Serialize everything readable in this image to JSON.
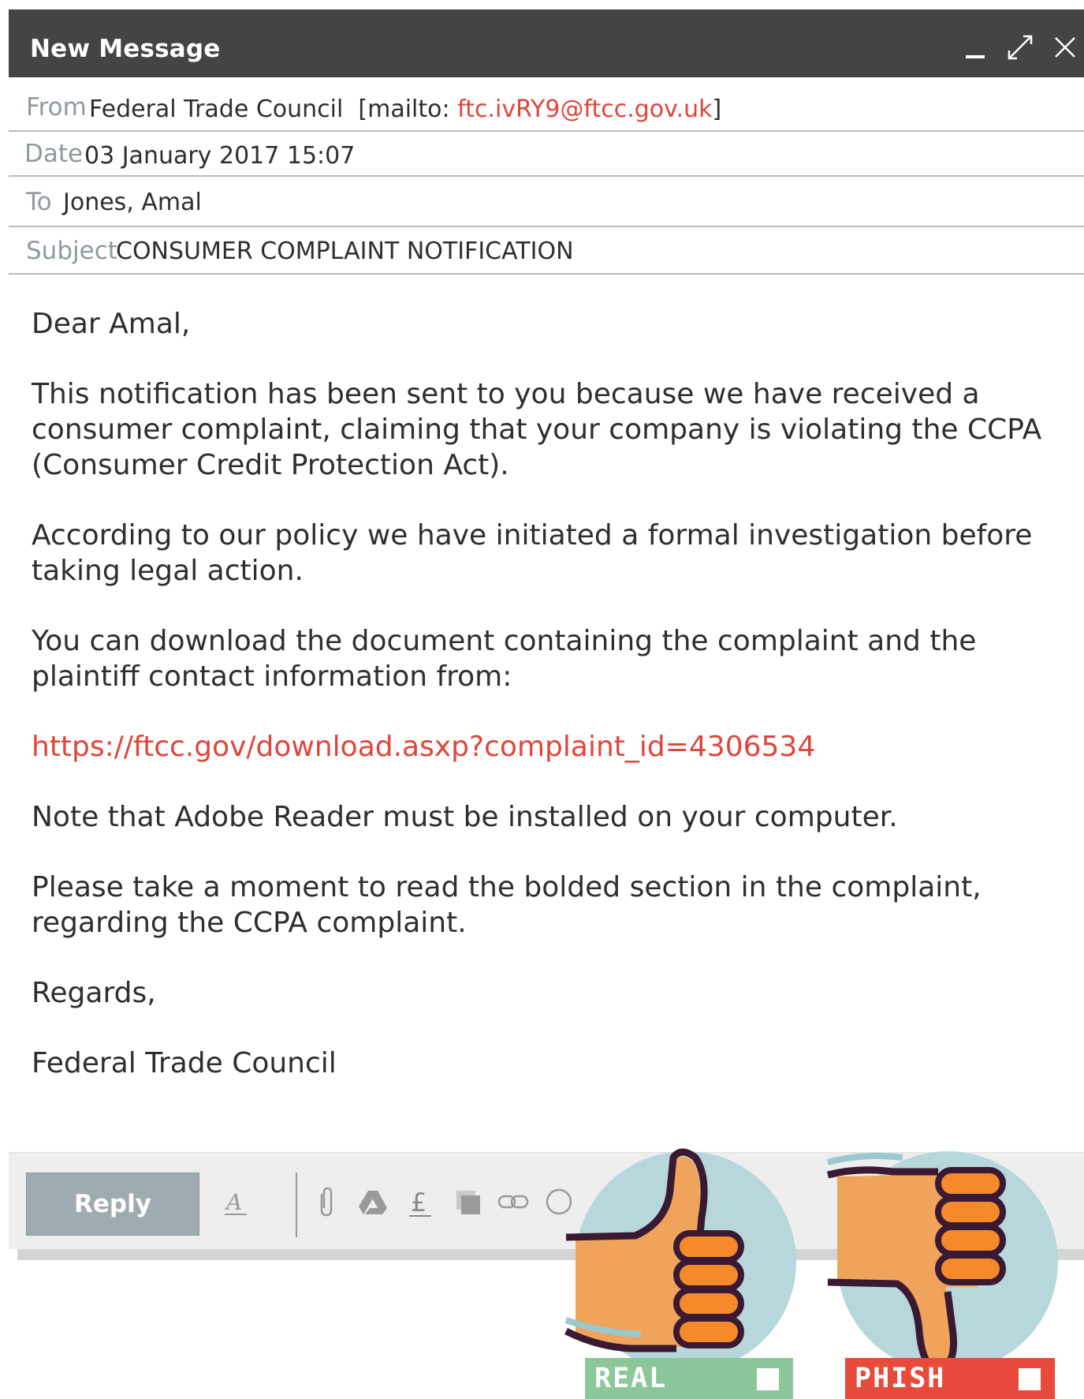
{
  "window": {
    "title": "New Message",
    "controls": [
      "minimize-icon",
      "expand-icon",
      "close-icon"
    ]
  },
  "headers": {
    "from_label": "From",
    "from_name": "Federal Trade Council",
    "from_mailto_prefix": "[mailto: ",
    "from_email": "ftc.ivRY9@ftcc.gov.uk",
    "from_mailto_suffix": "]",
    "date_label": "Date",
    "date_value": "03 January 2017 15:07",
    "to_label": "To",
    "to_value": "Jones, Amal",
    "subject_label": "Subject",
    "subject_value": "CONSUMER COMPLAINT NOTIFICATION"
  },
  "body": {
    "greeting": "Dear Amal,",
    "p1": "This notification has been sent to you because we have received a consumer complaint, claiming that your company is violating the CCPA (Consumer Credit Protection Act).",
    "p2": "According to our policy we have initiated a formal investigation before taking legal action.",
    "p3": "You can download the document containing the complaint and the plaintiff contact information from:",
    "link": "https://ftcc.gov/download.asxp?complaint_id=4306534",
    "p4": "Note that Adobe Reader must be installed on your computer.",
    "p5": "Please take a moment to read the bolded section in the complaint, regarding the CCPA complaint.",
    "closing": "Regards,",
    "signature": "Federal Trade Council"
  },
  "toolbar": {
    "reply_label": "Reply",
    "icons": [
      "format-text-icon",
      "attachment-icon",
      "drive-icon",
      "pound-icon",
      "photo-icon",
      "link-icon",
      "emoji-icon"
    ]
  },
  "vote": {
    "real_label": "REAL",
    "phish_label": "PHISH"
  },
  "colors": {
    "titlebar": "#444444",
    "link": "#e0453a",
    "label_gray": "#8e9a9e",
    "reply_button": "#9eabb0",
    "real_green": "#8cc79a",
    "phish_red": "#e84b3c",
    "circle_blue": "#b7d7dc",
    "hand_orange": "#f0a35a",
    "finger_orange": "#f58a2a",
    "outline": "#3a1a33"
  }
}
